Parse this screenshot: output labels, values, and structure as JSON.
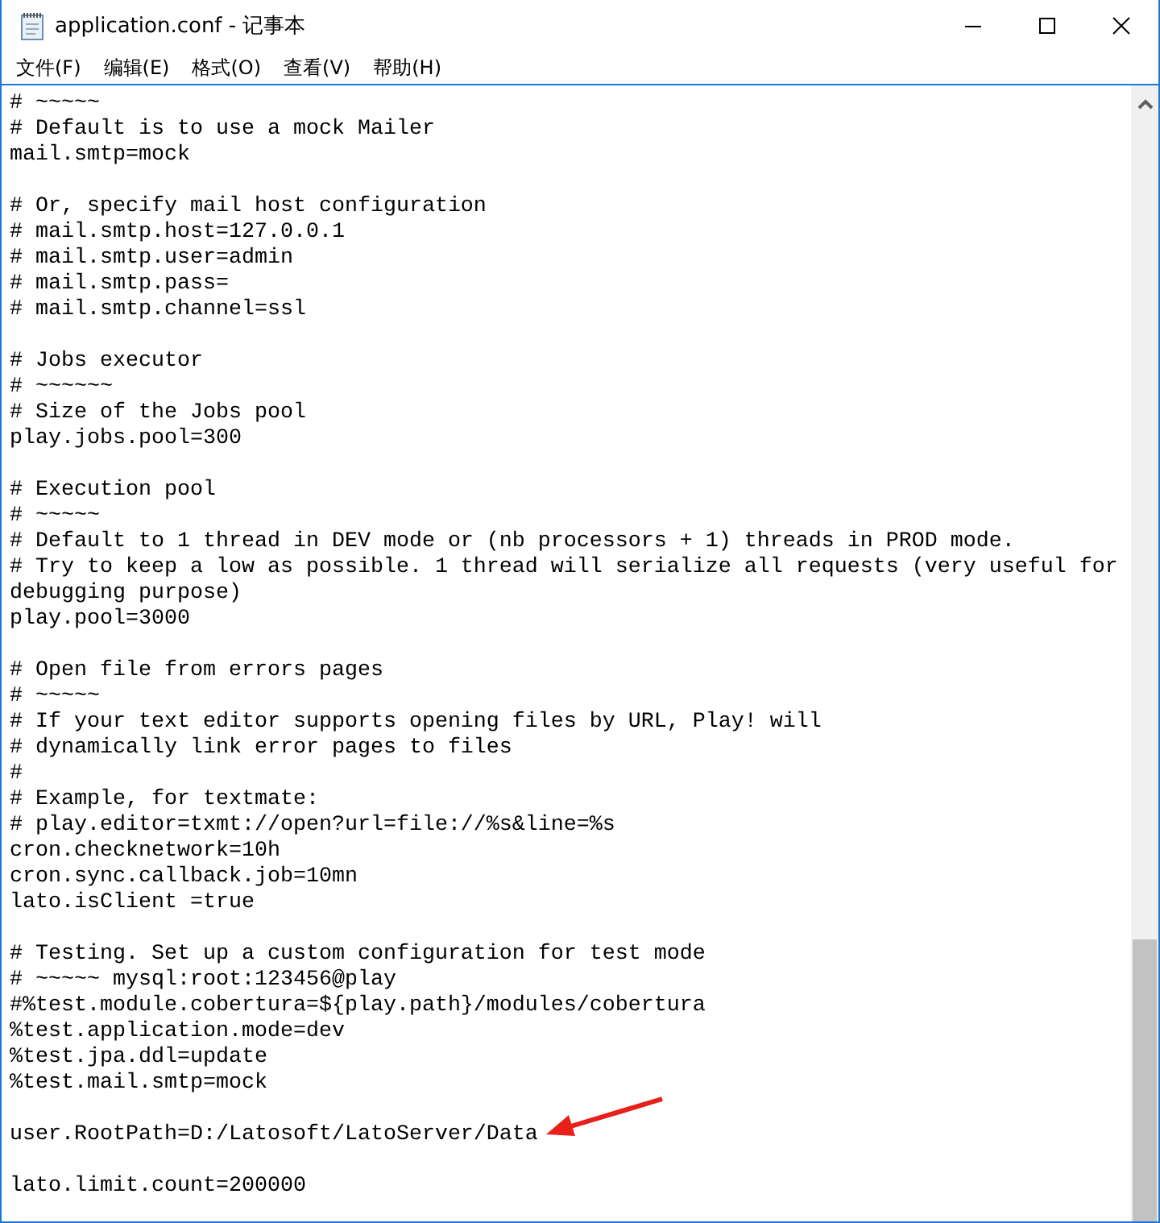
{
  "window": {
    "title": "application.conf - 记事本"
  },
  "menu": [
    "文件(F)",
    "编辑(E)",
    "格式(O)",
    "查看(V)",
    "帮助(H)"
  ],
  "editor": {
    "blocks": [
      [
        "# ~~~~~",
        "# Default is to use a mock Mailer",
        "mail.smtp=mock"
      ],
      [
        "# Or, specify mail host configuration",
        "# mail.smtp.host=127.0.0.1",
        "# mail.smtp.user=admin",
        "# mail.smtp.pass=",
        "# mail.smtp.channel=ssl"
      ],
      [
        "# Jobs executor",
        "# ~~~~~~",
        "# Size of the Jobs pool",
        "play.jobs.pool=300"
      ],
      [
        "# Execution pool",
        "# ~~~~~",
        "# Default to 1 thread in DEV mode or (nb processors + 1) threads in PROD mode.",
        "# Try to keep a low as possible. 1 thread will serialize all requests (very useful for",
        "debugging purpose)",
        "play.pool=3000"
      ],
      [
        "# Open file from errors pages",
        "# ~~~~~",
        "# If your text editor supports opening files by URL, Play! will",
        "# dynamically link error pages to files",
        "#",
        "# Example, for textmate:",
        "# play.editor=txmt://open?url=file://%s&line=%s",
        "cron.checknetwork=10h",
        "cron.sync.callback.job=10mn",
        "lato.isClient =true"
      ],
      [
        "# Testing. Set up a custom configuration for test mode",
        "# ~~~~~ mysql:root:123456@play",
        "#%test.module.cobertura=${play.path}/modules/cobertura",
        "%test.application.mode=dev",
        "%test.jpa.ddl=update",
        "%test.mail.smtp=mock"
      ],
      [
        "user.RootPath=D:/Latosoft/LatoServer/Data"
      ],
      [
        "lato.limit.count=200000"
      ]
    ]
  }
}
